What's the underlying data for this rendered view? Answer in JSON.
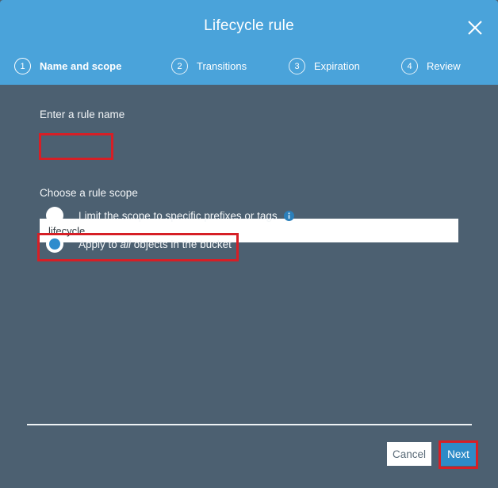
{
  "dialog": {
    "title": "Lifecycle rule",
    "close_icon": "close-icon"
  },
  "steps": [
    {
      "number": "1",
      "label": "Name and scope",
      "active": true
    },
    {
      "number": "2",
      "label": "Transitions",
      "active": false
    },
    {
      "number": "3",
      "label": "Expiration",
      "active": false
    },
    {
      "number": "4",
      "label": "Review",
      "active": false
    }
  ],
  "form": {
    "rule_name_label": "Enter a rule name",
    "rule_name_value": "lifecycle",
    "rule_name_placeholder": "",
    "rule_scope_label": "Choose a rule scope",
    "scope_options": [
      {
        "label_prefix": "Limit the scope to specific prefixes or tags",
        "label_italic": "",
        "label_suffix": "",
        "selected": false,
        "has_info_icon": true
      },
      {
        "label_prefix": "Apply to ",
        "label_italic": "all",
        "label_suffix": " objects in the bucket",
        "selected": true,
        "has_info_icon": false
      }
    ]
  },
  "footer": {
    "cancel_label": "Cancel",
    "next_label": "Next"
  },
  "colors": {
    "header_blue": "#4aa3da",
    "body_slate": "#4c6071",
    "accent_blue": "#2e8bc7",
    "annotation_red": "#d61f26",
    "radio_selected_blue": "#2e8ccd"
  }
}
